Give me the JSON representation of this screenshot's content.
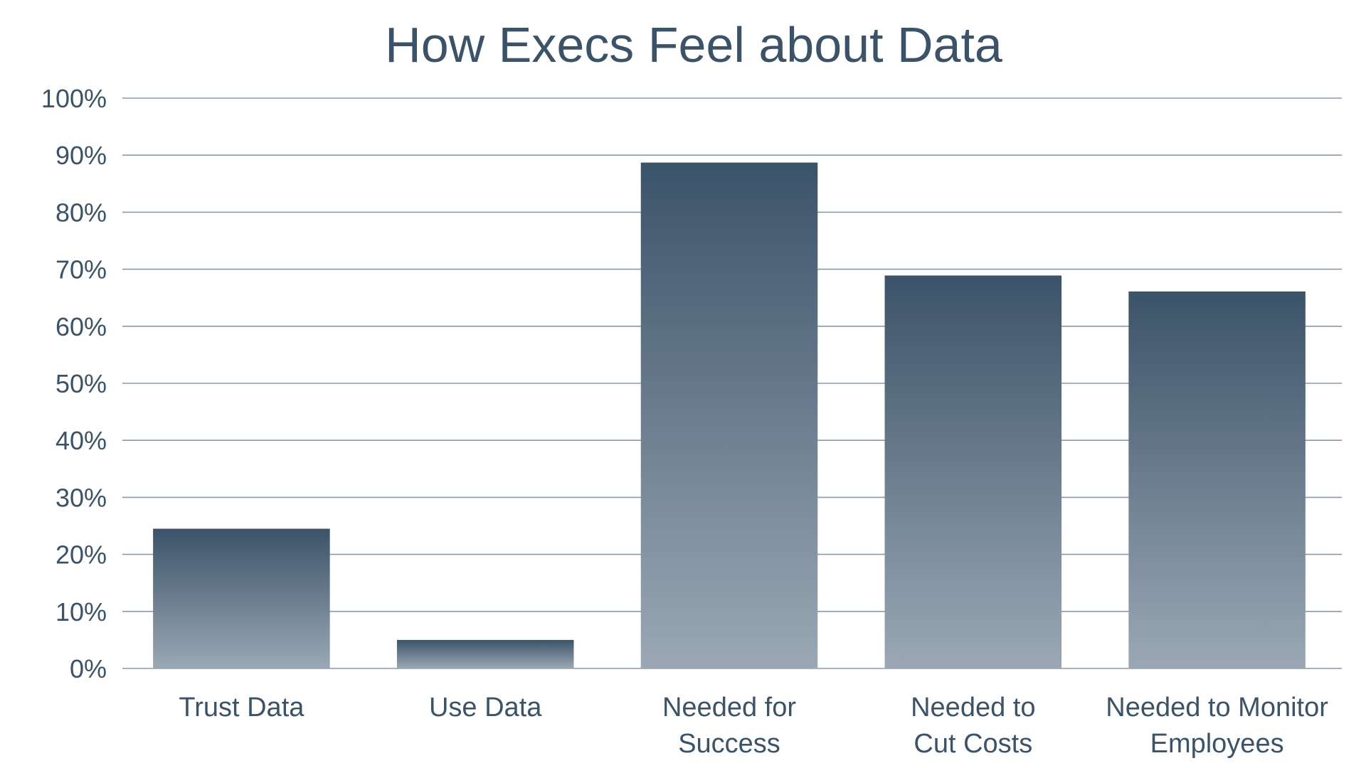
{
  "chart_data": {
    "type": "bar",
    "title": "How Execs Feel about Data",
    "xlabel": "",
    "ylabel": "",
    "categories": [
      [
        "Trust Data"
      ],
      [
        "Use Data"
      ],
      [
        "Needed for",
        "Success"
      ],
      [
        "Needed to",
        "Cut Costs"
      ],
      [
        "Needed to Monitor",
        "Employees"
      ]
    ],
    "values": [
      24.5,
      5,
      88.7,
      68.9,
      66.1
    ],
    "ylim": [
      0,
      100
    ],
    "yticks": [
      0,
      10,
      20,
      30,
      40,
      50,
      60,
      70,
      80,
      90,
      100
    ],
    "ytick_labels": [
      "0%",
      "10%",
      "20%",
      "30%",
      "40%",
      "50%",
      "60%",
      "70%",
      "80%",
      "90%",
      "100%"
    ],
    "grid": true,
    "legend": "none",
    "colors": {
      "bar_top": "#3b5369",
      "bar_bottom": "#9ba8b4",
      "text": "#3b5369",
      "grid": "#8a9aab"
    }
  }
}
